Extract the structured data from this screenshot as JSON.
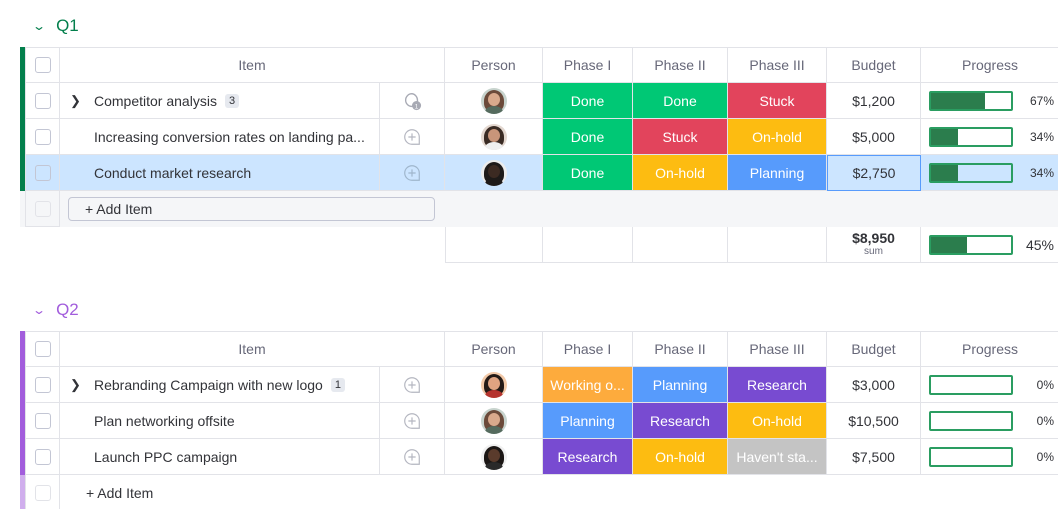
{
  "colors": {
    "q1_accent": "#037f4c",
    "q2_accent": "#a25ddc",
    "done": "#00c875",
    "stuck": "#e2445c",
    "on_hold": "#fdbc11",
    "planning": "#579bfc",
    "research": "#784bd1",
    "working_on": "#fdab3d",
    "not_started": "#c4c4c4",
    "selected_row": "#cce5ff",
    "progress_fill": "#2b7d4d"
  },
  "columns": {
    "item": "Item",
    "person": "Person",
    "phase1": "Phase I",
    "phase2": "Phase II",
    "phase3": "Phase III",
    "budget": "Budget",
    "progress": "Progress"
  },
  "groups": [
    {
      "title": "Q1",
      "rows": [
        {
          "item": "Competitor analysis",
          "subitems": "3",
          "expandable": true,
          "person": "avatar-1",
          "phase1": "Done",
          "phase2": "Done",
          "phase3": "Stuck",
          "budget": "$1,200",
          "progress": 0.67,
          "progress_label": "67%",
          "update": "active"
        },
        {
          "item": "Increasing conversion rates on landing pa...",
          "subitems": "",
          "expandable": false,
          "person": "avatar-2",
          "phase1": "Done",
          "phase2": "Stuck",
          "phase3": "On-hold",
          "budget": "$5,000",
          "progress": 0.34,
          "progress_label": "34%",
          "update": "add"
        },
        {
          "item": "Conduct market research",
          "subitems": "",
          "expandable": false,
          "person": "avatar-3",
          "phase1": "Done",
          "phase2": "On-hold",
          "phase3": "Planning",
          "budget": "$2,750",
          "progress": 0.34,
          "progress_label": "34%",
          "update": "add",
          "selected": true
        }
      ],
      "add_item": "+ Add Item",
      "summary": {
        "budget": "$8,950",
        "budget_caption": "sum",
        "progress": 0.45,
        "progress_label": "45%"
      }
    },
    {
      "title": "Q2",
      "rows": [
        {
          "item": "Rebranding Campaign with new logo",
          "subitems": "1",
          "expandable": true,
          "person": "avatar-4",
          "phase1": "Working o...",
          "phase2": "Planning",
          "phase3": "Research",
          "budget": "$3,000",
          "progress": 0,
          "progress_label": "0%",
          "update": "add"
        },
        {
          "item": "Plan networking offsite",
          "subitems": "",
          "expandable": false,
          "person": "avatar-1",
          "phase1": "Planning",
          "phase2": "Research",
          "phase3": "On-hold",
          "budget": "$10,500",
          "progress": 0,
          "progress_label": "0%",
          "update": "add"
        },
        {
          "item": "Launch PPC campaign",
          "subitems": "",
          "expandable": false,
          "person": "avatar-5",
          "phase1": "Research",
          "phase2": "On-hold",
          "phase3": "Haven't sta...",
          "budget": "$7,500",
          "progress": 0,
          "progress_label": "0%",
          "update": "add"
        }
      ],
      "add_item": "+ Add Item"
    }
  ],
  "icons": {
    "expand": "chevron-right-icon",
    "collapse": "chevron-down-icon",
    "update_add": "chat-plus-icon",
    "update_active": "chat-count-icon"
  }
}
